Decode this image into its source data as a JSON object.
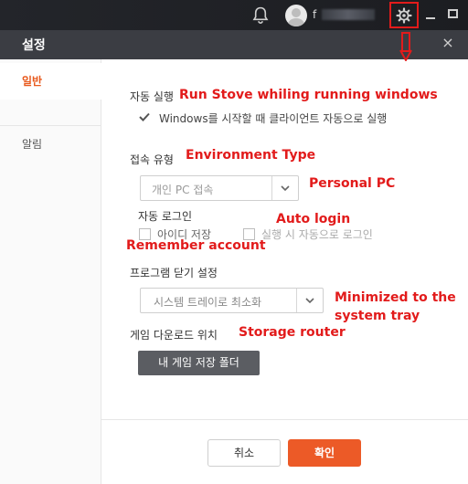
{
  "topbar": {
    "username": "f",
    "icons": [
      "bell-icon",
      "user-avatar",
      "gear-icon",
      "minimize-icon",
      "maximize-icon"
    ]
  },
  "dialog": {
    "title": "설정",
    "close_label": "×"
  },
  "sidebar": {
    "items": [
      {
        "label": "일반",
        "active": true
      },
      {
        "label": "알림",
        "active": false
      }
    ]
  },
  "general": {
    "auto_run": {
      "title": "자동 실행",
      "checkbox_label": "Windows를 시작할 때 클라이언트 자동으로 실행",
      "checked": true
    },
    "connection_type": {
      "title": "접속 유형",
      "selected": "개인 PC 접속"
    },
    "auto_login": {
      "title": "자동 로그인",
      "save_id_label": "아이디 저장",
      "save_id_checked": false,
      "auto_login_label": "실행 시 자동으로 로그인",
      "auto_login_checked": false
    },
    "program_close": {
      "title": "프로그램 닫기 설정",
      "selected": "시스템 트레이로 최소화"
    },
    "download_location": {
      "title": "게임 다운로드 위치",
      "button_label": "내 게임 저장 폴더"
    }
  },
  "footer": {
    "cancel_label": "취소",
    "ok_label": "확인"
  },
  "annotations": {
    "run_stove": "Run Stove whiling running windows",
    "environment_type": "Environment Type",
    "personal_pc": "Personal PC",
    "auto_login": "Auto login",
    "remember_account": "Remember account",
    "minimized_line1": "Minimized to the",
    "minimized_line2": "system tray",
    "storage_router": "Storage router"
  },
  "colors": {
    "accent": "#ec5a27",
    "annotation_red": "#e21b1b",
    "header_dark": "#3b3d43"
  }
}
